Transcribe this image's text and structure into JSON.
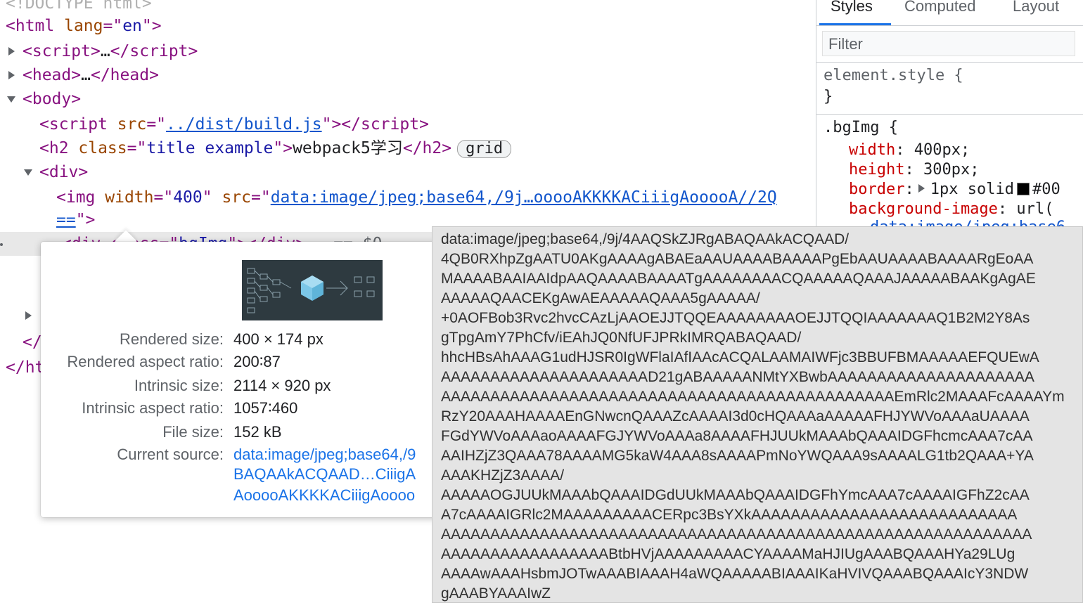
{
  "elements_tree": {
    "doctype_partial": "<!DOCTYPE html>",
    "html_tag": "html",
    "html_attr_name": "lang",
    "html_attr_value": "en",
    "script_collapsed": "script",
    "head_collapsed": "head",
    "ellipsis": "…",
    "body_tag": "body",
    "script_src_name": "src",
    "script_src_value": "../dist/build.js",
    "h2_class_name": "class",
    "h2_class_value": "title example",
    "h2_text": "webpack5学习",
    "grid_badge": "grid",
    "div_tag": "div",
    "img_width_name": "width",
    "img_width_value": "400",
    "img_src_name": "src",
    "img_src_value": "data:image/jpeg;base64,/9j…ooooAKKKKACiiigAooooA//2Q",
    "img_src_tail": "==",
    "selected_div_class": "bgImg",
    "selected_marker": "== $0",
    "closing_html_partial": "</ht"
  },
  "sidebar": {
    "tabs": [
      "Styles",
      "Computed",
      "Layout"
    ],
    "active_tab": "Styles",
    "filter_placeholder": "Filter",
    "element_style_selector": "element.style {",
    "close_brace": "}",
    "bgimg_selector": ".bgImg {",
    "declarations": [
      {
        "prop": "width",
        "value": "400px;"
      },
      {
        "prop": "height",
        "value": "300px;"
      },
      {
        "prop": "border",
        "value": "1px solid"
      },
      {
        "prop": "background-image",
        "value": "url("
      }
    ],
    "border_color_partial": "#00",
    "bg_url_partial": "data:image/jpeg;base6"
  },
  "image_tooltip": {
    "rows": [
      {
        "label": "Rendered size:",
        "value": "400 × 174 px"
      },
      {
        "label": "Rendered aspect ratio:",
        "value": "200∶87"
      },
      {
        "label": "Intrinsic size:",
        "value": "2114 × 920 px"
      },
      {
        "label": "Intrinsic aspect ratio:",
        "value": "1057∶460"
      },
      {
        "label": "File size:",
        "value": "152 kB"
      },
      {
        "label": "Current source:",
        "value": "data:image/jpeg;base64,/9"
      }
    ],
    "source_line2": "BAQAAkACQAAD…CiiigA",
    "source_line3": "AooooAKKKKACiiigAoooo"
  },
  "url_tooltip": {
    "lines": [
      "data:image/jpeg;base64,/9j/4AAQSkZJRgABAQAAkACQAAD/",
      "4QB0RXhpZgAATU0AKgAAAAgABAEaAAUAAAABAAAAPgEbAAUAAAABAAAARgEoAA",
      "MAAAABAAIAAIdpAAQAAAABAAAATgAAAAAAAACQAAAAAQAAAJAAAAABAAKgAgAE",
      "AAAAAQAACEKgAwAEAAAAAQAAA5gAAAAA/",
      "+0AOFBob3Rvc2hvcCAzLjAAOEJJTQQEAAAAAAAAOEJJTQQIAAAAAAAQ1B2M2Y8As",
      "gTpgAmY7PhCfv/iEAhJQ0NfUFJPRkIMRQABAQAAD/",
      "hhcHBsAhAAAG1udHJSR0IgWFlaIAfIAAcACQALAAMAIWFjc3BBUFBMAAAAAEFQUEwA",
      "AAAAAAAAAAAAAAAAAAAAAD21gABAAAAANMtYXBwbAAAAAAAAAAAAAAAAAAAAA",
      "AAAAAAAAAAAAAAAAAAAAAAAAAAAAAAAAAAAAAAAAAAAAAAEmRlc2MAAAFcAAAAYm",
      "RzY20AAAHAAAAEnGNwcnQAAAZcAAAAI3d0cHQAAAaAAAAAFHJYWVoAAAaUAAAA",
      "FGdYWVoAAAaoAAAAFGJYWVoAAAa8AAAAFHJUUkMAAAbQAAAIDGFhcmcAAA7cAA",
      "AAIHZjZ3QAAA78AAAAMG5kaW4AAA8sAAAAPmNoYWQAAA9sAAAALG1tb2QAAA+YA",
      "AAAKHZjZ3AAAA/",
      "AAAAAOGJUUkMAAAbQAAAIDGdUUkMAAAbQAAAIDGFhYmcAAA7cAAAAIGFhZ2cAA",
      "A7cAAAAIGRlc2MAAAAAAAAACERpc3BsYXkAAAAAAAAAAAAAAAAAAAAAAAAAAA",
      "AAAAAAAAAAAAAAAAAAAAAAAAAAAAAAAAAAAAAAAAAAAAAAAAAAAAAAAAAAAA",
      "AAAAAAAAAAAAAAAAABtbHVjAAAAAAAAACYAAAAMaHJIUgAAABQAAAHYa29LUg",
      "AAAAwAAAHsbmJOTwAAABIAAAH4aWQAAAAABIAAAIKaHVIVQAAABQAAAIcY3NDW",
      "gAAABYAAAIwZ"
    ]
  },
  "colors": {
    "tag": "#881280",
    "attr_name": "#994500",
    "attr_value": "#1a1aa6",
    "link": "#1155cc",
    "css_property": "#c80000",
    "active_tab_underline": "#1a73e8"
  }
}
